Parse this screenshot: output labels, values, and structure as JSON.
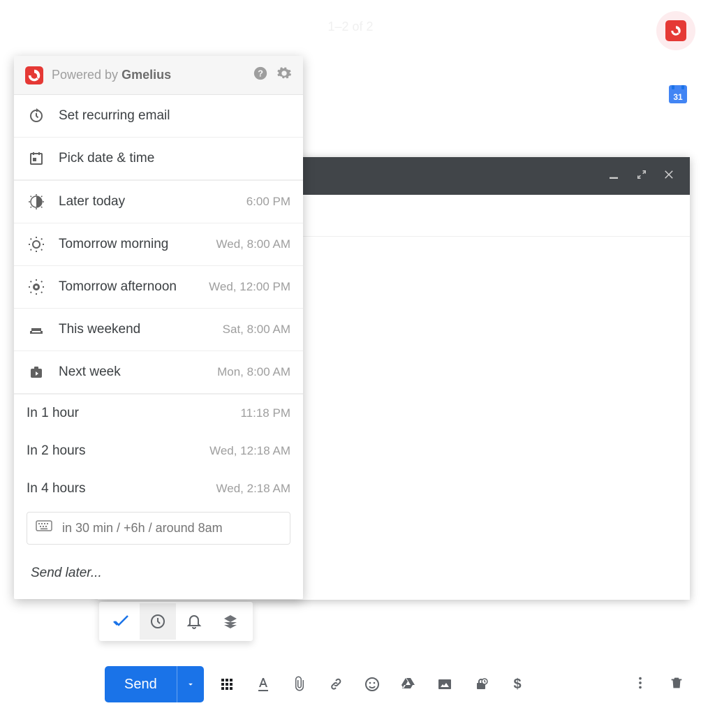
{
  "top": {
    "count_text": "1–2 of 2",
    "calendar_day": "31"
  },
  "popup": {
    "powered_by_prefix": "Powered by ",
    "powered_by_brand": "Gmelius",
    "actions": [
      {
        "icon": "recurring-icon",
        "label": "Set recurring email",
        "time": ""
      },
      {
        "icon": "calendar-pick-icon",
        "label": "Pick date & time",
        "time": ""
      }
    ],
    "presets": [
      {
        "icon": "later-today-icon",
        "label": "Later today",
        "time": "6:00 PM"
      },
      {
        "icon": "morning-icon",
        "label": "Tomorrow morning",
        "time": "Wed, 8:00 AM"
      },
      {
        "icon": "afternoon-icon",
        "label": "Tomorrow afternoon",
        "time": "Wed, 12:00 PM"
      },
      {
        "icon": "weekend-icon",
        "label": "This weekend",
        "time": "Sat, 8:00 AM"
      },
      {
        "icon": "next-week-icon",
        "label": "Next week",
        "time": "Mon, 8:00 AM"
      }
    ],
    "relative": [
      {
        "label": "In 1 hour",
        "time": "11:18 PM"
      },
      {
        "label": "In 2 hours",
        "time": "Wed, 12:18 AM"
      },
      {
        "label": "In 4 hours",
        "time": "Wed, 2:18 AM"
      }
    ],
    "nl_placeholder": "in 30 min / +6h / around 8am",
    "send_later_label": "Send later..."
  },
  "send": {
    "button_label": "Send"
  }
}
